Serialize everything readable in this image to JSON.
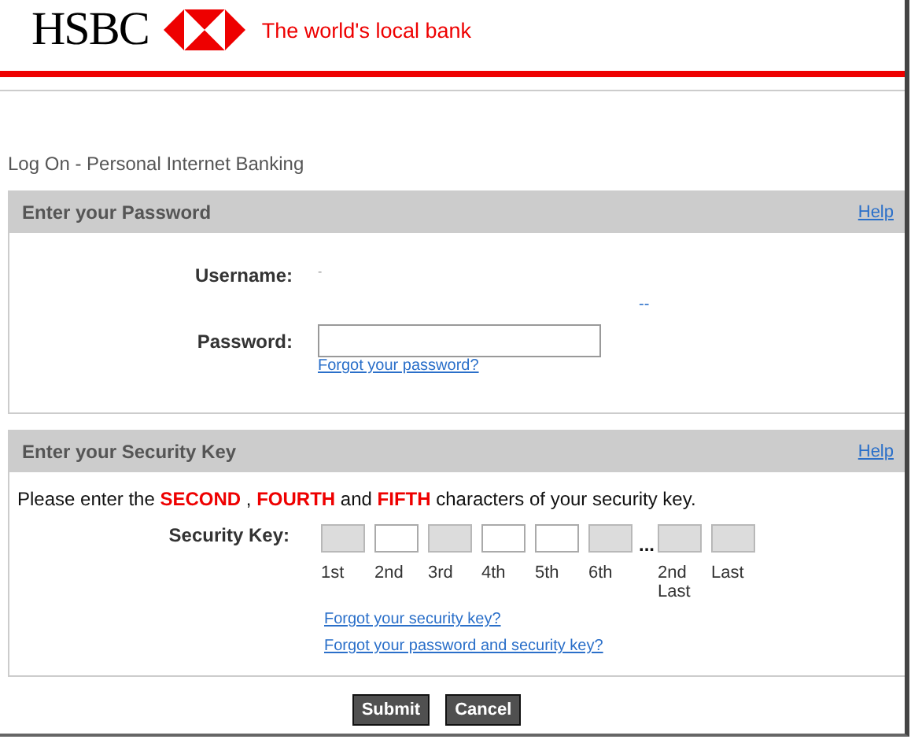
{
  "header": {
    "brand": "HSBC",
    "tagline": "The world's local bank"
  },
  "page_title": "Log On - Personal Internet Banking",
  "password_panel": {
    "title": "Enter your Password",
    "help": "Help",
    "username_label": "Username:",
    "username_value": "-",
    "extra_link": "--",
    "password_label": "Password:",
    "forgot_link": "Forgot your password?"
  },
  "security_panel": {
    "title": "Enter your Security Key",
    "help": "Help",
    "instruction": [
      {
        "text": "Please enter the ",
        "emphasis": false
      },
      {
        "text": "SECOND",
        "emphasis": true
      },
      {
        "text": " , ",
        "emphasis": false
      },
      {
        "text": "FOURTH",
        "emphasis": true
      },
      {
        "text": " and ",
        "emphasis": false
      },
      {
        "text": "FIFTH",
        "emphasis": true
      },
      {
        "text": " characters of your security key.",
        "emphasis": false
      }
    ],
    "key_label": "Security Key:",
    "boxes": [
      {
        "label": "1st",
        "disabled": true
      },
      {
        "label": "2nd",
        "disabled": false
      },
      {
        "label": "3rd",
        "disabled": true
      },
      {
        "label": "4th",
        "disabled": false
      },
      {
        "label": "5th",
        "disabled": false
      },
      {
        "label": "6th",
        "disabled": true
      },
      {
        "kind": "gap",
        "label": "..."
      },
      {
        "label": "2nd Last",
        "disabled": true
      },
      {
        "label": "Last",
        "disabled": true
      }
    ],
    "links": [
      "Forgot your security key?",
      "Forgot your password and security key?"
    ]
  },
  "buttons": [
    "Submit",
    "Cancel"
  ]
}
